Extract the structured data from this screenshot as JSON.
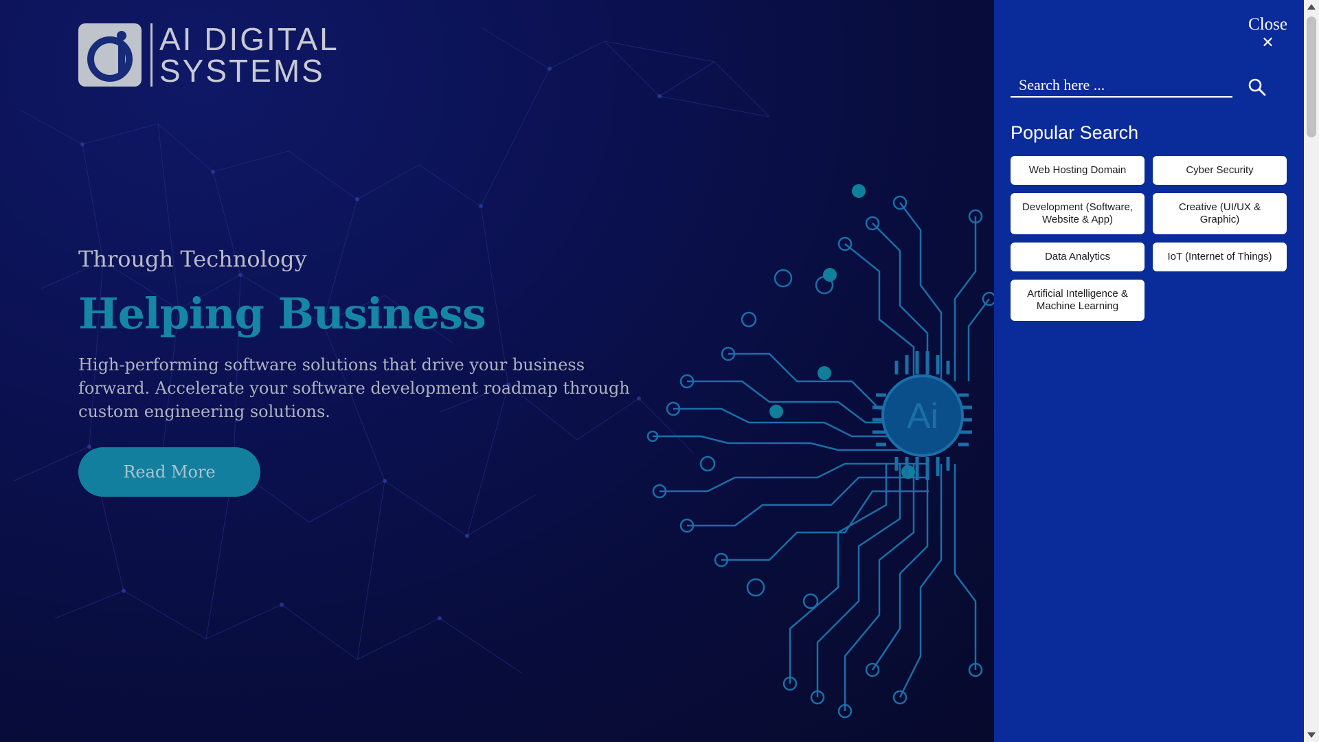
{
  "logo": {
    "line1": "AI DIGITAL",
    "line2": "SYSTEMS",
    "icon": "ai-logo-icon"
  },
  "hero": {
    "eyebrow": "Through Technology",
    "headline": "Helping Business",
    "description": "High-performing software solutions that drive your business forward. Accelerate your software development roadmap through custom engineering solutions.",
    "cta_label": "Read More",
    "chip_text": "Ai"
  },
  "panel": {
    "close_label": "Close",
    "close_icon": "close-icon",
    "search_placeholder": "Search here ...",
    "search_icon": "search-icon",
    "popular_title": "Popular Search",
    "chips": [
      "Web Hosting Domain",
      "Cyber Security",
      "Development (Software, Website & App)",
      "Creative (UI/UX & Graphic)",
      "Data Analytics",
      "IoT (Internet of Things)",
      "Artificial Intelligence & Machine Learning"
    ]
  },
  "colors": {
    "hero_bg": "#0a0f45",
    "accent": "#1586a4",
    "button": "#137f9f",
    "panel_bg": "#0a2b9a",
    "chip_bg": "#ffffff"
  }
}
